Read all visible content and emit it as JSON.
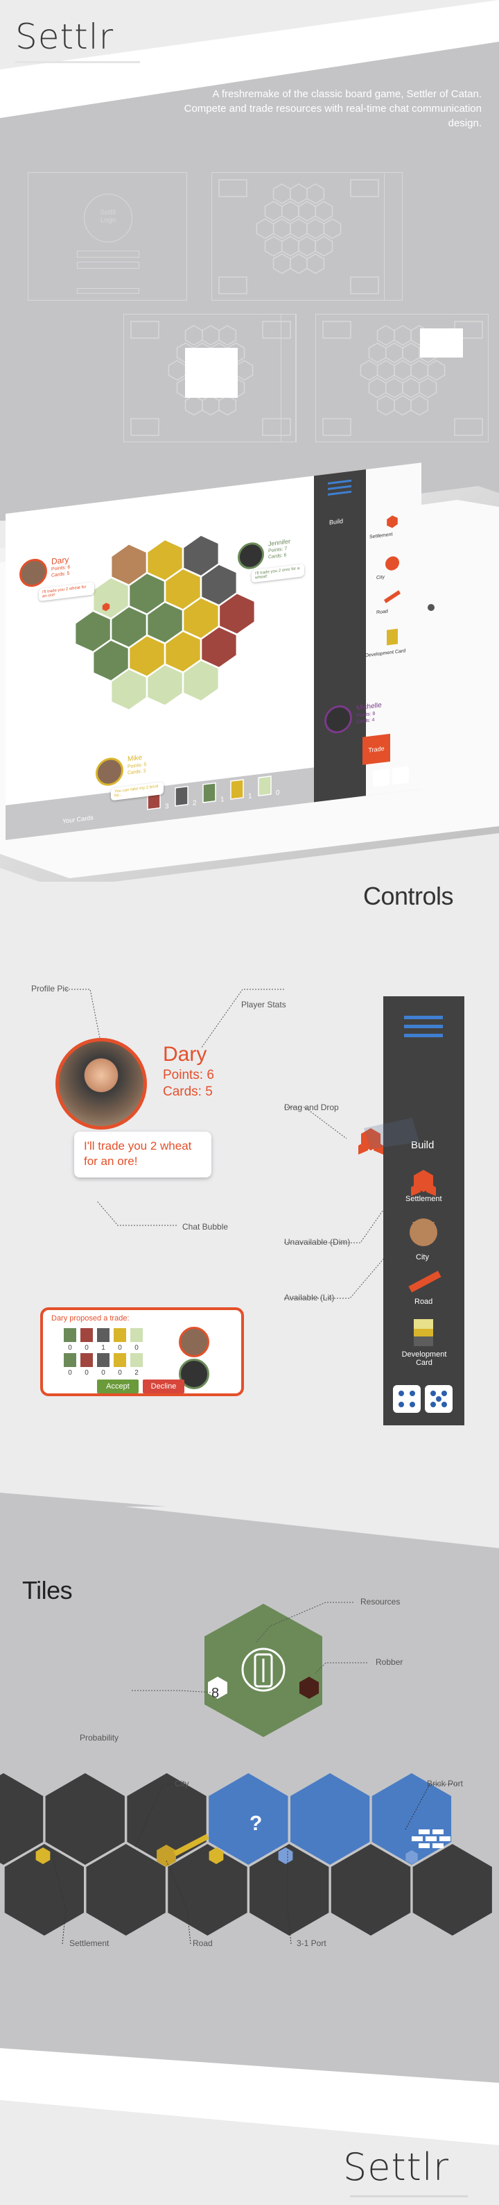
{
  "header": {
    "brand": "Settlr",
    "description": "A freshremake of the classic board game, Settler of Catan. Compete and trade resources with real-time chat communication design."
  },
  "wireframe_login": {
    "logo_text": "Settlr Logo"
  },
  "board": {
    "players": [
      {
        "name": "Dary",
        "points": "Points: 6",
        "cards": "Cards: 5",
        "bubble": "I'll trade you 2 wheat for an ore!"
      },
      {
        "name": "Jennifer",
        "points": "Points: 7",
        "cards": "Cards: 6",
        "bubble": "I'll trade you 2 ores for a wheat!"
      },
      {
        "name": "Michelle",
        "points": "Points: 8",
        "cards": "Cards: 4"
      },
      {
        "name": "Mike",
        "points": "Points: 5",
        "cards": "Cards: 3",
        "bubble": "You can take my 2 brick for..."
      }
    ],
    "build_label": "Build",
    "build_items": [
      "Settlement",
      "City",
      "Road",
      "Development Card"
    ],
    "trade_button": "Trade",
    "your_cards": "Your Cards",
    "card_counts": [
      "3",
      "2",
      "1",
      "1",
      "0"
    ]
  },
  "controls": {
    "title": "Controls",
    "labels": {
      "profile_pic": "Profile Pic",
      "player_stats": "Player Stats",
      "chat_bubble": "Chat Bubble",
      "drag_drop": "Drag and Drop",
      "unavailable": "Unavailable (Dim)",
      "available": "Available (Lit)"
    },
    "player": {
      "name": "Dary",
      "points": "Points: 6",
      "cards": "Cards: 5"
    },
    "bubble": "I'll trade you 2 wheat for an ore!",
    "build_label": "Build",
    "build_items": [
      "Settlement",
      "City",
      "Road",
      "Development Card"
    ],
    "trade_panel": {
      "title": "Dary proposed a trade:",
      "row1_counts": [
        "0",
        "0",
        "1",
        "0",
        "0"
      ],
      "row2_counts": [
        "0",
        "0",
        "0",
        "0",
        "2"
      ],
      "accept": "Accept",
      "decline": "Decline"
    }
  },
  "tiles": {
    "title": "Tiles",
    "labels": {
      "resources": "Resources",
      "robber": "Robber",
      "probability": "Probability",
      "city": "City",
      "brick_port": "Brick Port",
      "settlement": "Settlement",
      "road": "Road",
      "port31": "3-1 Port"
    },
    "probability_number": "8",
    "port_symbol": "?"
  },
  "footer": {
    "brand": "Settlr"
  },
  "colors": {
    "accent": "#e4502a",
    "grass": "#6b8a58",
    "wheat": "#d9b52b",
    "ore": "#5d5d5d",
    "brick": "#a0463f",
    "sheep": "#cfe0b3",
    "desert": "#b8845a",
    "dark_hex": "#3d3d3d",
    "water": "#4a7cc4",
    "panel": "#414141"
  }
}
